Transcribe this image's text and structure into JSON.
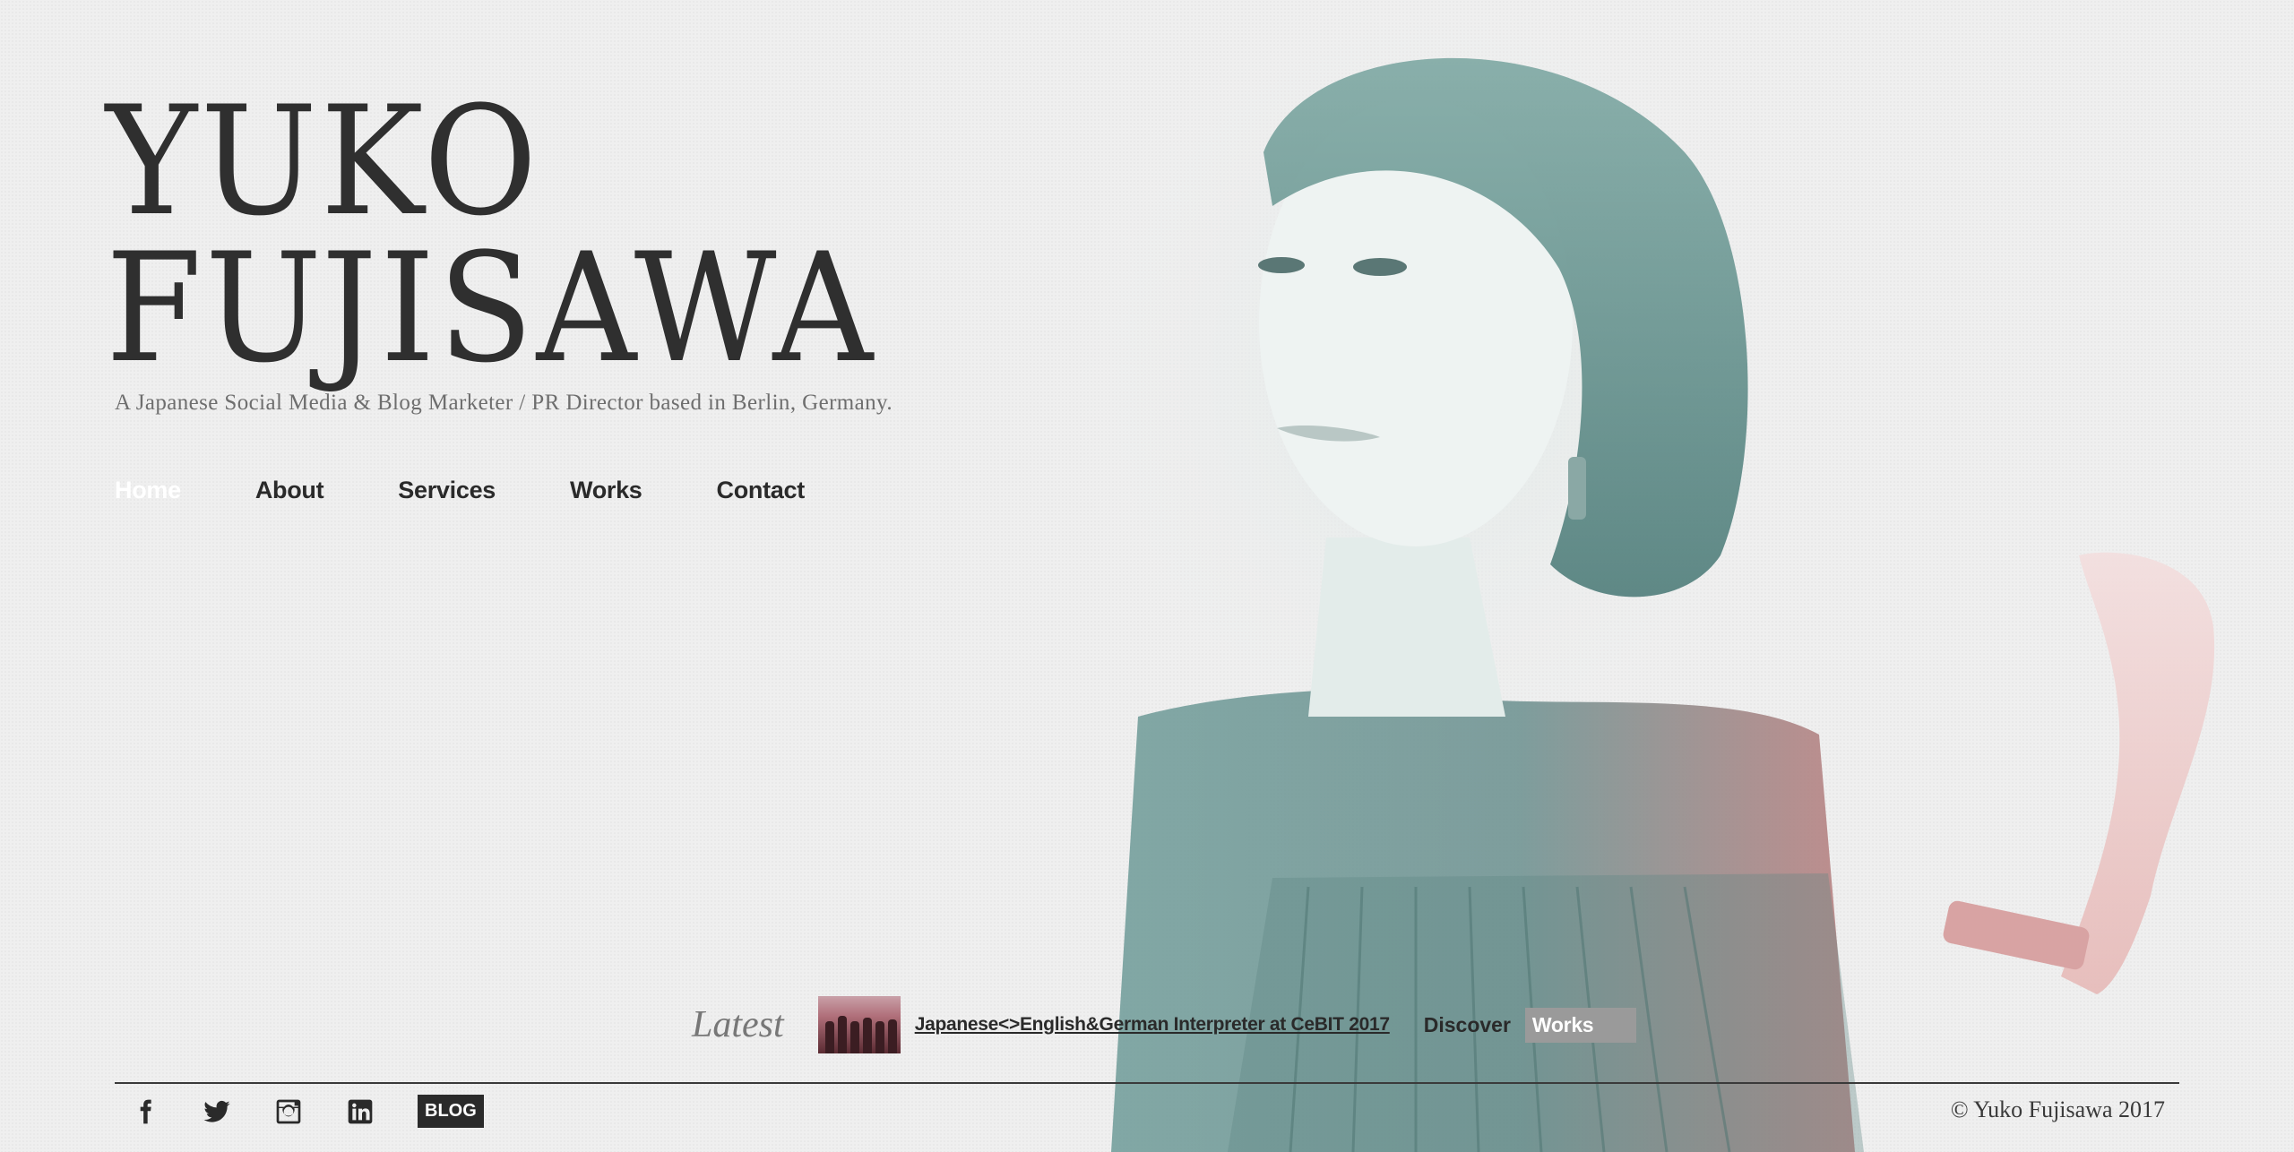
{
  "site": {
    "title_line1": "YUKO",
    "title_line2": "FUJISAWA",
    "tagline": "A Japanese Social Media & Blog Marketer / PR Director based in Berlin, Germany."
  },
  "nav": {
    "items": [
      {
        "label": "Home",
        "active": true
      },
      {
        "label": "About",
        "active": false
      },
      {
        "label": "Services",
        "active": false
      },
      {
        "label": "Works",
        "active": false
      },
      {
        "label": "Contact",
        "active": false
      }
    ]
  },
  "latest": {
    "label": "Latest",
    "post_title": "Japanese<>English&German Interpreter at CeBIT 2017",
    "discover_label": "Discover",
    "discover_button": "Works"
  },
  "footer": {
    "social": [
      {
        "icon": "facebook-icon"
      },
      {
        "icon": "twitter-icon"
      },
      {
        "icon": "instagram-icon"
      },
      {
        "icon": "linkedin-icon"
      }
    ],
    "blog_label": "BLOG",
    "copyright": "© Yuko Fujisawa 2017"
  },
  "colors": {
    "background": "#efefef",
    "text": "#2d2d2d",
    "portrait_teal": "#5f8f8c",
    "portrait_rose": "#b4787a",
    "button_grey": "#9a9a9a"
  }
}
